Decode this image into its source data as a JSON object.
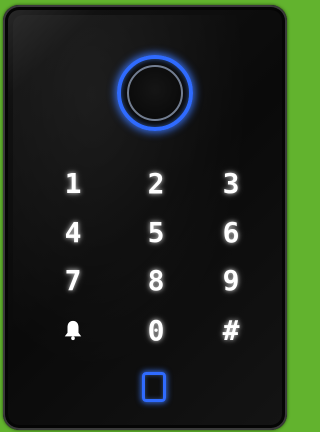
{
  "keypad": {
    "keys": {
      "k1": "1",
      "k2": "2",
      "k3": "3",
      "k4": "4",
      "k5": "5",
      "k6": "6",
      "k7": "7",
      "k8": "8",
      "k9": "9",
      "k0": "0",
      "hash": "#"
    },
    "bell_icon": "bell-icon",
    "card_icon": "card-reader-icon",
    "fingerprint_icon": "fingerprint-reader-icon"
  },
  "colors": {
    "background": "#62b32e",
    "panel": "#0b0b0b",
    "digit": "#ffffff",
    "accent_led": "#2f6bff"
  }
}
